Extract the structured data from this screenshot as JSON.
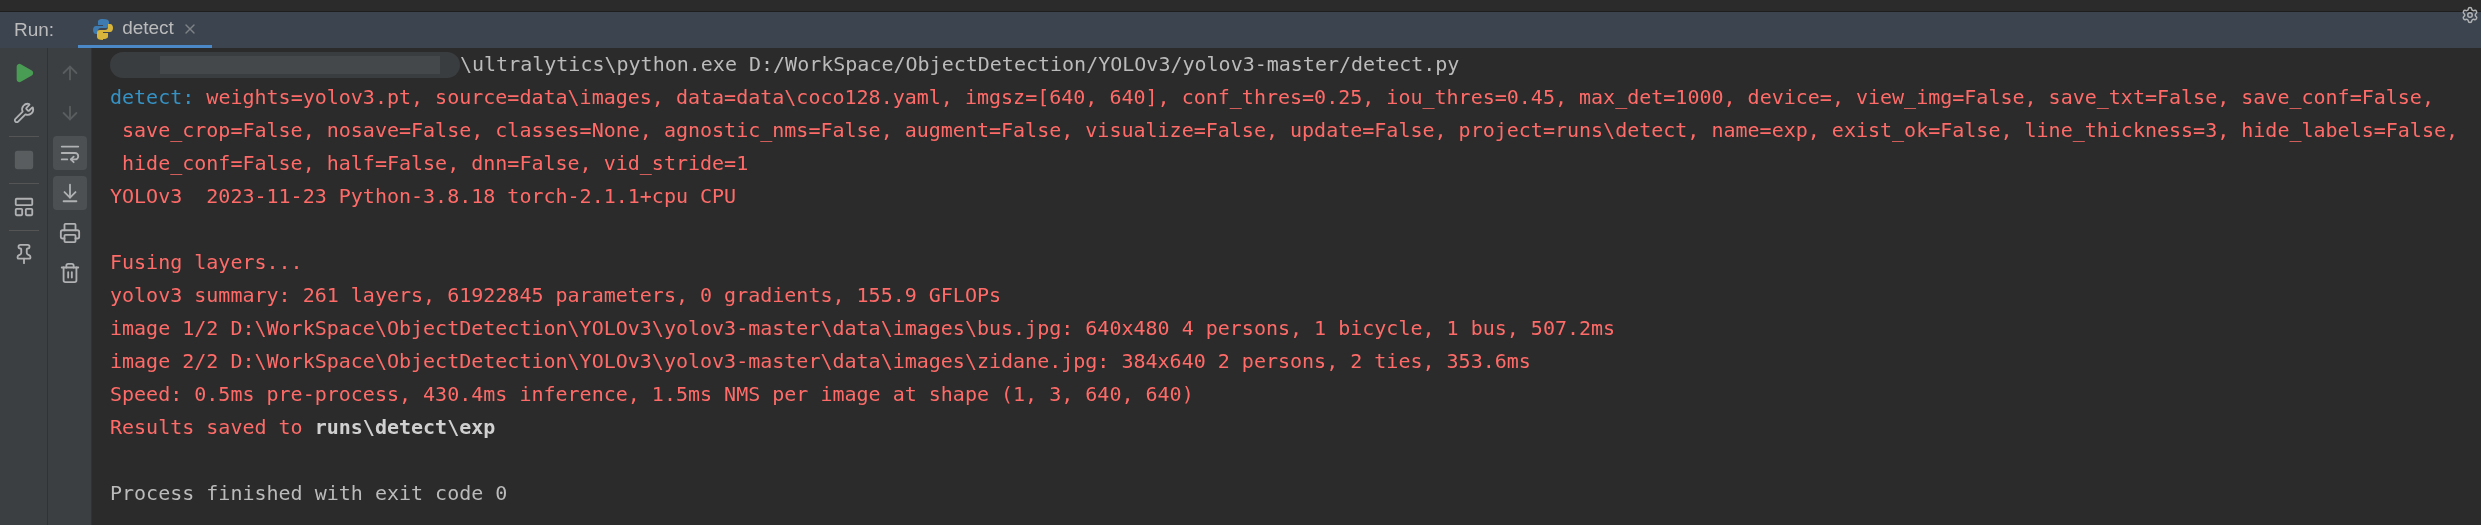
{
  "run_panel": {
    "label": "Run:",
    "tabs": [
      {
        "title": "detect",
        "selected": true
      }
    ]
  },
  "primary_toolbar": [
    {
      "kind": "run",
      "disabled": false
    },
    {
      "kind": "wrench",
      "disabled": false
    },
    {
      "kind": "stop",
      "disabled": true
    },
    {
      "kind": "layout",
      "disabled": false
    },
    {
      "kind": "pin",
      "disabled": false
    }
  ],
  "secondary_toolbar": [
    {
      "kind": "up",
      "disabled": true,
      "on": false
    },
    {
      "kind": "down",
      "disabled": true,
      "on": false
    },
    {
      "kind": "wrap",
      "disabled": false,
      "on": true
    },
    {
      "kind": "scroll_end",
      "disabled": false,
      "on": true
    },
    {
      "kind": "print",
      "disabled": false,
      "on": false
    },
    {
      "kind": "trash",
      "disabled": false,
      "on": false
    }
  ],
  "console": {
    "lines": [
      {
        "kind": "command",
        "segments": [
          {
            "kind": "system",
            "text": "\\ultralytics\\python.exe D:/WorkSpace/ObjectDetection/YOLOv3/yolov3-master/detect.py"
          }
        ]
      },
      {
        "kind": "text",
        "segments": [
          {
            "kind": "prefix",
            "text": "detect:"
          },
          {
            "kind": "error",
            "text": " weights=yolov3.pt, source=data\\images, data=data\\coco128.yaml, imgsz=[640, 640], conf_thres=0.25, iou_thres=0.45, max_det=1000, device=, view_img=False, save_txt=False, save_conf=False,"
          }
        ]
      },
      {
        "kind": "text",
        "segments": [
          {
            "kind": "error",
            "text": " save_crop=False, nosave=False, classes=None, agnostic_nms=False, augment=False, visualize=False, update=False, project=runs\\detect, name=exp, exist_ok=False, line_thickness=3, hide_labels=False,"
          }
        ]
      },
      {
        "kind": "text",
        "segments": [
          {
            "kind": "error",
            "text": " hide_conf=False, half=False, dnn=False, vid_stride=1"
          }
        ]
      },
      {
        "kind": "text",
        "segments": [
          {
            "kind": "error",
            "text": "YOLOv3  2023-11-23 Python-3.8.18 torch-2.1.1+cpu CPU"
          }
        ]
      },
      {
        "kind": "blank"
      },
      {
        "kind": "text",
        "segments": [
          {
            "kind": "error",
            "text": "Fusing layers..."
          }
        ]
      },
      {
        "kind": "text",
        "segments": [
          {
            "kind": "error",
            "text": "yolov3 summary: 261 layers, 61922845 parameters, 0 gradients, 155.9 GFLOPs"
          }
        ]
      },
      {
        "kind": "text",
        "segments": [
          {
            "kind": "error",
            "text": "image 1/2 D:\\WorkSpace\\ObjectDetection\\YOLOv3\\yolov3-master\\data\\images\\bus.jpg: 640x480 4 persons, 1 bicycle, 1 bus, 507.2ms"
          }
        ]
      },
      {
        "kind": "text",
        "segments": [
          {
            "kind": "error",
            "text": "image 2/2 D:\\WorkSpace\\ObjectDetection\\YOLOv3\\yolov3-master\\data\\images\\zidane.jpg: 384x640 2 persons, 2 ties, 353.6ms"
          }
        ]
      },
      {
        "kind": "text",
        "segments": [
          {
            "kind": "error",
            "text": "Speed: 0.5ms pre-process, 430.4ms inference, 1.5ms NMS per image at shape (1, 3, 640, 640)"
          }
        ]
      },
      {
        "kind": "text",
        "segments": [
          {
            "kind": "error",
            "text": "Results saved to "
          },
          {
            "kind": "bold",
            "text": "runs\\detect\\exp"
          }
        ]
      },
      {
        "kind": "blank"
      },
      {
        "kind": "text",
        "segments": [
          {
            "kind": "system",
            "text": "Process finished with exit code 0"
          }
        ]
      }
    ]
  }
}
